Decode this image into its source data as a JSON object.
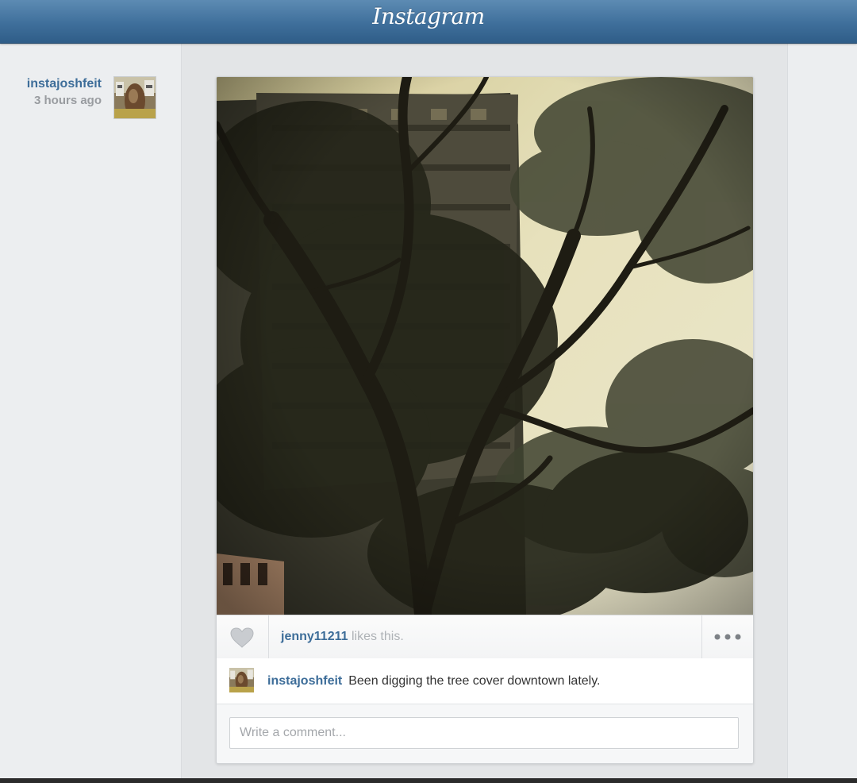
{
  "header": {
    "logo_text": "Instagram"
  },
  "post": {
    "author": {
      "username": "instajoshfeit",
      "time_ago": "3 hours ago",
      "avatar_icon": "user-avatar-photo"
    },
    "photo": {
      "icon": "tree-canopy-photo"
    },
    "likes": {
      "user": "jenny11211",
      "suffix": " likes this.",
      "like_icon": "heart-icon",
      "more_icon": "more-options-icon"
    },
    "caption": {
      "username": "instajoshfeit",
      "text": "Been digging the tree cover downtown lately."
    },
    "comment": {
      "placeholder": "Write a comment..."
    }
  },
  "colors": {
    "header_blue": "#3f6f9b",
    "link_blue": "#3d6d99",
    "muted_gray": "#aeb2b6"
  }
}
